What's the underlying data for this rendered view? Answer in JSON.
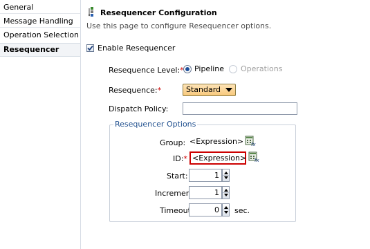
{
  "sidebar": {
    "items": [
      {
        "label": "General"
      },
      {
        "label": "Message Handling"
      },
      {
        "label": "Operation Selection"
      },
      {
        "label": "Resequencer",
        "selected": true
      }
    ]
  },
  "header": {
    "icon": "resequencer-icon",
    "title": "Resequencer Configuration",
    "subtitle": "Use this page to configure Resequencer options."
  },
  "enable": {
    "label": "Enable Resequencer",
    "checked": true
  },
  "level": {
    "label": "Resequence Level:",
    "required_mark": "*",
    "options": [
      {
        "label": "Pipeline",
        "selected": true,
        "enabled": true
      },
      {
        "label": "Operations",
        "selected": false,
        "enabled": false
      }
    ]
  },
  "resequence": {
    "label": "Resequence:",
    "required_mark": "*",
    "value": "Standard"
  },
  "dispatch": {
    "label": "Dispatch Policy:",
    "value": ""
  },
  "options_group": {
    "title": "Resequencer Options",
    "group": {
      "label": "Group:",
      "value": "<Expression>",
      "icon": "expression-editor-icon"
    },
    "id": {
      "label": "ID:",
      "required_mark": "*",
      "value": "<Expression>",
      "icon": "expression-editor-icon",
      "error": true
    },
    "start": {
      "label": "Start:",
      "value": "1"
    },
    "increment": {
      "label": "Increment:",
      "value": "1"
    },
    "timeout": {
      "label": "Timeout:",
      "value": "0",
      "unit": "sec."
    }
  },
  "colors": {
    "error_border": "#cc0000",
    "group_title": "#1f4f8e",
    "select_bg": "#f8c97d",
    "radio_selected": "#1d4f9a"
  }
}
